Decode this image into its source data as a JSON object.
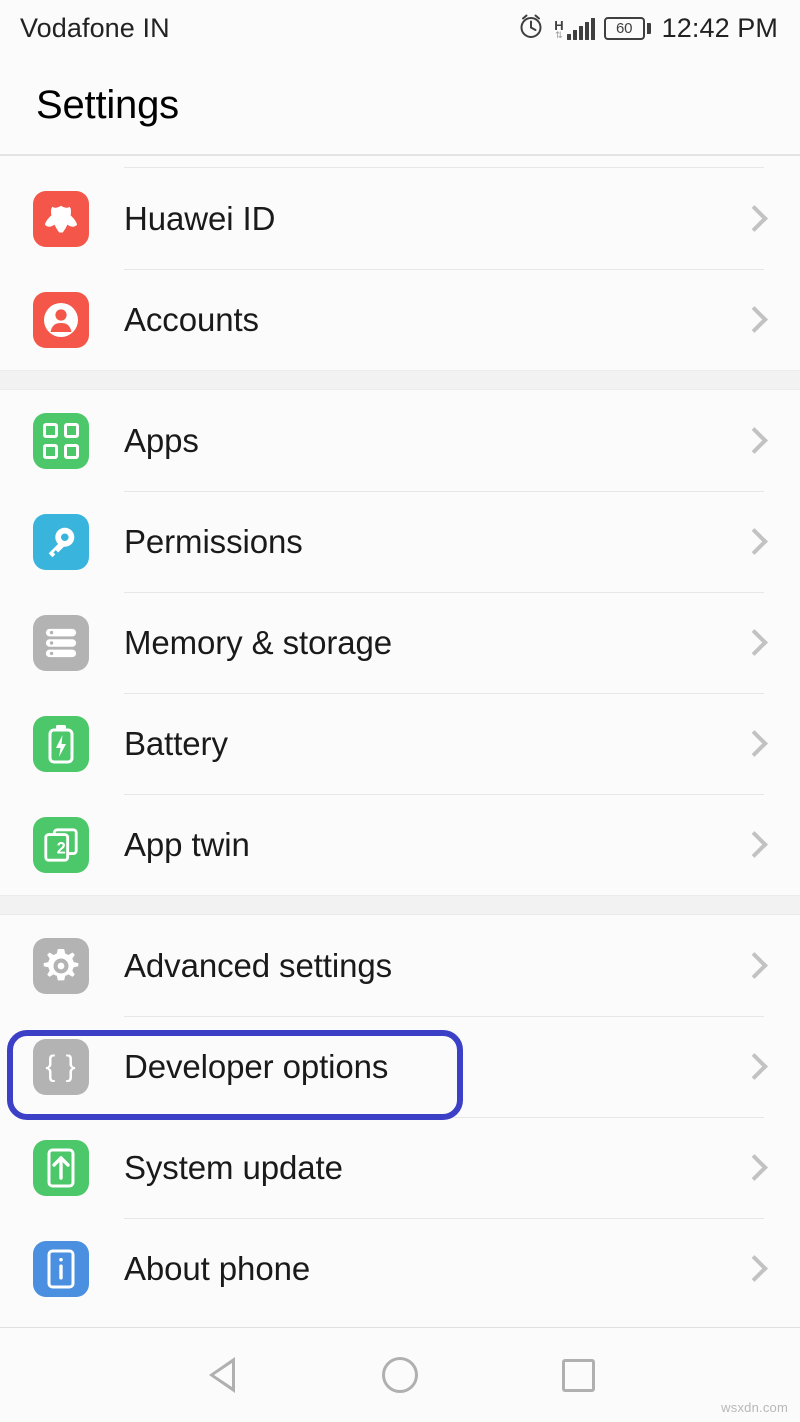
{
  "statusbar": {
    "carrier": "Vodafone IN",
    "alarm_icon": "alarm-clock-icon",
    "network_type": "H",
    "network_arrows": "⇅",
    "signal_icon": "signal-bars-icon",
    "battery_level": "60",
    "time": "12:42 PM"
  },
  "header": {
    "title": "Settings"
  },
  "groups": [
    {
      "items": [
        {
          "label": "Huawei ID",
          "icon": "huawei-logo-icon",
          "icon_color": "#f4564a"
        },
        {
          "label": "Accounts",
          "icon": "person-icon",
          "icon_color": "#f4564a"
        }
      ]
    },
    {
      "items": [
        {
          "label": "Apps",
          "icon": "apps-grid-icon",
          "icon_color": "#4cc76a"
        },
        {
          "label": "Permissions",
          "icon": "key-icon",
          "icon_color": "#39b5dd"
        },
        {
          "label": "Memory & storage",
          "icon": "storage-stack-icon",
          "icon_color": "#b3b3b3"
        },
        {
          "label": "Battery",
          "icon": "battery-bolt-icon",
          "icon_color": "#4cc76a"
        },
        {
          "label": "App twin",
          "icon": "app-twin-icon",
          "icon_color": "#4cc76a"
        }
      ]
    },
    {
      "items": [
        {
          "label": "Advanced settings",
          "icon": "gear-icon",
          "icon_color": "#b3b3b3"
        },
        {
          "label": "Developer options",
          "icon": "code-braces-icon",
          "icon_color": "#b3b3b3",
          "highlighted": true
        },
        {
          "label": "System update",
          "icon": "phone-arrow-up-icon",
          "icon_color": "#4cc76a"
        },
        {
          "label": "About phone",
          "icon": "phone-info-icon",
          "icon_color": "#4a8fe0"
        }
      ]
    }
  ],
  "highlight": {
    "color": "#3c40c6",
    "target": "Developer options"
  },
  "navbar": {
    "back": "back-triangle-icon",
    "home": "home-circle-icon",
    "recents": "recents-square-icon"
  },
  "watermark": "wsxdn.com"
}
